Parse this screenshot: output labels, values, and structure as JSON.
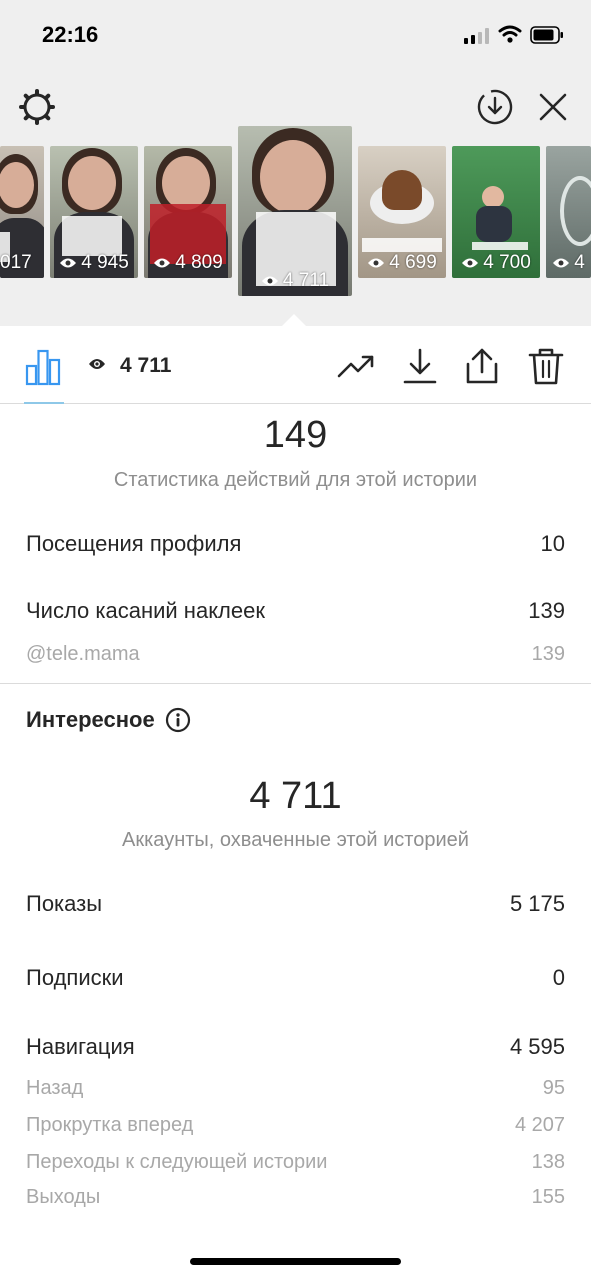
{
  "status_bar": {
    "time": "22:16"
  },
  "header": {
    "settings_icon": "gear-icon",
    "download_icon": "download-circle-icon",
    "close_icon": "close-icon"
  },
  "thumbnails": [
    {
      "views": "017"
    },
    {
      "views": "4 945"
    },
    {
      "views": "4 809"
    },
    {
      "views": "4 711",
      "selected": true
    },
    {
      "views": "4 699"
    },
    {
      "views": "4 700"
    },
    {
      "views": "4"
    }
  ],
  "toolbar": {
    "views_count": "4 711",
    "icons": [
      "bar-chart-icon",
      "eye-icon",
      "trending-icon",
      "download-icon",
      "share-icon",
      "trash-icon"
    ]
  },
  "actions": {
    "total": "149",
    "caption": "Статистика действий для этой истории",
    "rows": [
      {
        "label": "Посещения профиля",
        "value": "10"
      },
      {
        "label": "Число касаний наклеек",
        "value": "139"
      }
    ],
    "sticker": {
      "label": "@tele.mama",
      "value": "139"
    }
  },
  "discovery": {
    "title": "Интересное",
    "reach": "4 711",
    "caption": "Аккаунты, охваченные этой историей",
    "impressions": {
      "label": "Показы",
      "value": "5 175"
    },
    "follows": {
      "label": "Подписки",
      "value": "0"
    },
    "navigation": {
      "label": "Навигация",
      "value": "4 595"
    },
    "nav_rows": [
      {
        "label": "Назад",
        "value": "95"
      },
      {
        "label": "Прокрутка вперед",
        "value": "4 207"
      },
      {
        "label": "Переходы к следующей истории",
        "value": "138"
      },
      {
        "label": "Выходы",
        "value": "155"
      }
    ]
  },
  "colors": {
    "accent": "#3897f0",
    "muted": "#8e8e8e",
    "top_bg": "#efefef"
  }
}
